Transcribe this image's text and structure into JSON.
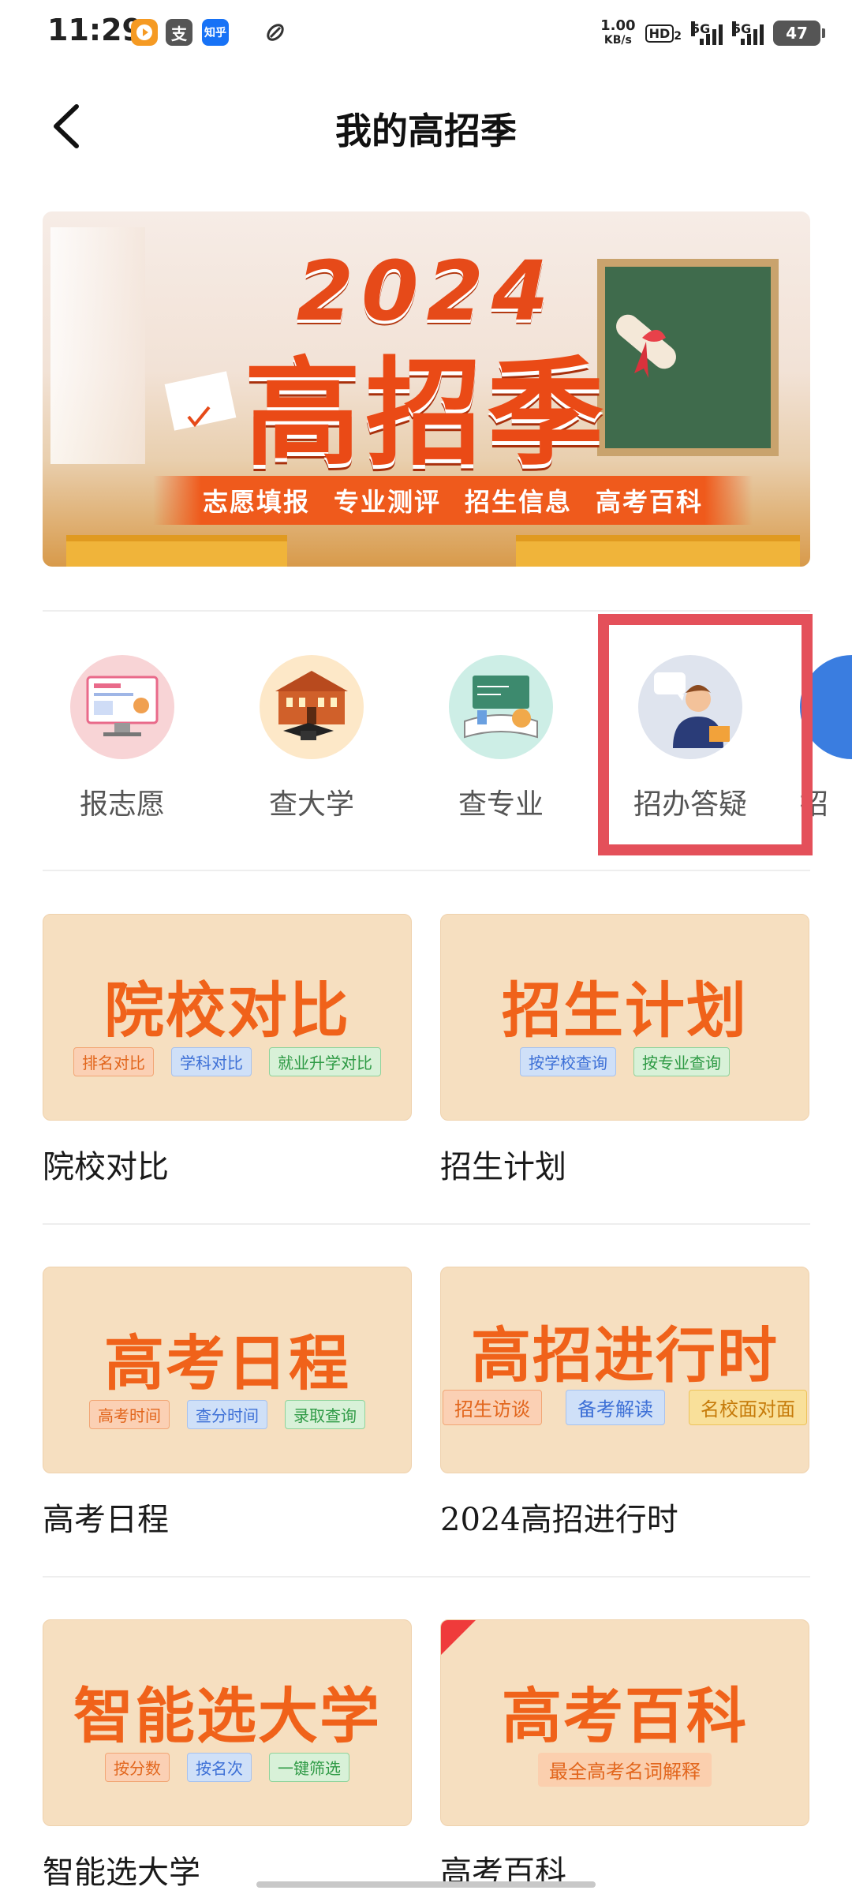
{
  "status_bar": {
    "time": "11:29",
    "apps": [
      "video-app-icon",
      "alipay-icon",
      "zhihu-icon",
      "link-icon"
    ],
    "alipay_glyph": "支",
    "zhihu_glyph": "知乎",
    "net_speed_value": "1.00",
    "net_speed_unit": "KB/s",
    "hd_label": "HD",
    "hd_sub": "2",
    "signal_label_1": "5G",
    "signal_label_2": "5G",
    "battery": "47"
  },
  "header": {
    "title": "我的高招季"
  },
  "banner": {
    "year": "2024",
    "title": "高招季",
    "items": [
      "志愿填报",
      "专业测评",
      "招生信息",
      "高考百科"
    ]
  },
  "quick_nav": [
    {
      "label": "报志愿",
      "icon": "application-form-icon"
    },
    {
      "label": "查大学",
      "icon": "university-icon"
    },
    {
      "label": "查专业",
      "icon": "major-books-icon"
    },
    {
      "label": "招办答疑",
      "icon": "consultant-icon"
    },
    {
      "label": "招",
      "icon": "partial-icon"
    }
  ],
  "cards": [
    {
      "big": "院校对比",
      "tags": [
        "排名对比",
        "学科对比",
        "就业升学对比"
      ],
      "title": "院校对比"
    },
    {
      "big": "招生计划",
      "tags": [
        "按学校查询",
        "按专业查询"
      ],
      "title": "招生计划"
    },
    {
      "big": "高考日程",
      "tags": [
        "高考时间",
        "查分时间",
        "录取查询"
      ],
      "title": "高考日程"
    },
    {
      "big": "高招进行时",
      "tags": [
        "招生访谈",
        "备考解读",
        "名校面对面"
      ],
      "title": "2024高招进行时"
    },
    {
      "big": "智能选大学",
      "tags": [
        "按分数",
        "按名次",
        "一键筛选"
      ],
      "title": "智能选大学"
    },
    {
      "big": "高考百科",
      "tags": [
        "最全高考名词解释"
      ],
      "title": "高考百科"
    }
  ],
  "colors": {
    "accent": "#f0621a",
    "highlight": "#e4505a",
    "card_bg": "#f6dfc0"
  }
}
